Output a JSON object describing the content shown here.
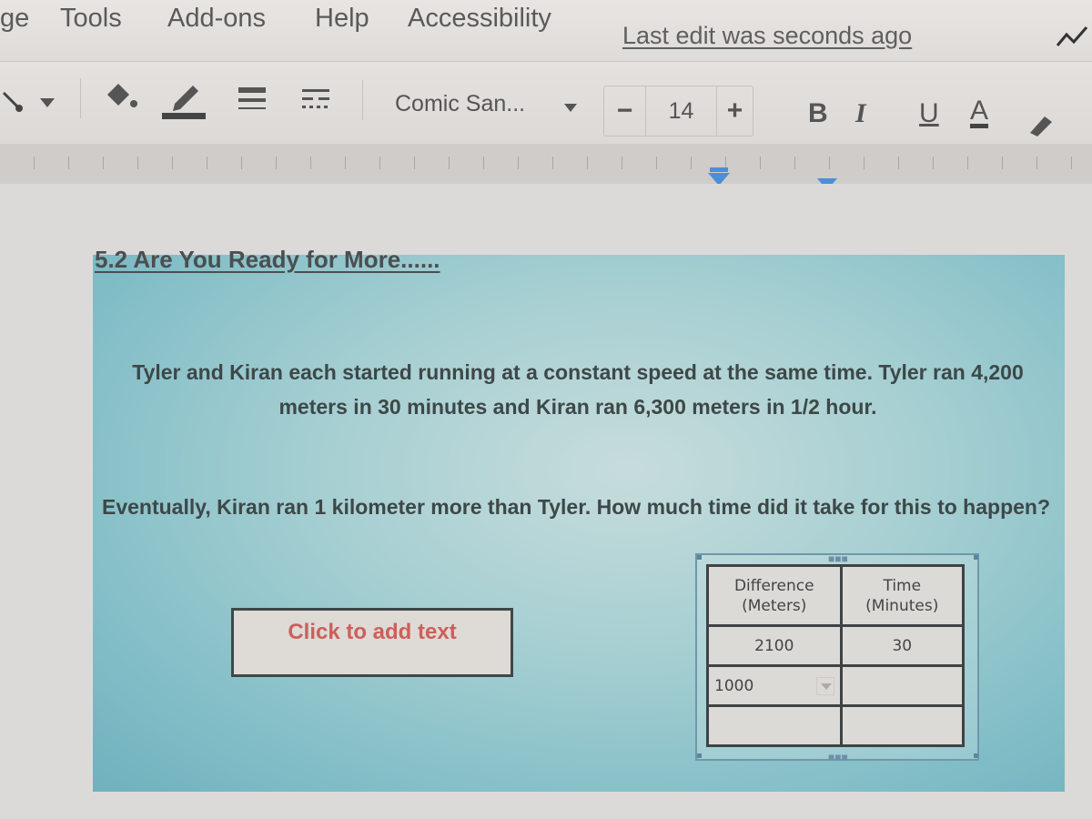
{
  "menubar": {
    "items": [
      "ge",
      "Tools",
      "Add-ons",
      "Help",
      "Accessibility"
    ],
    "last_edit": "Last edit was seconds ago"
  },
  "toolbar": {
    "icons": [
      "line-tool-icon",
      "fill-color-icon",
      "border-color-icon",
      "border-weight-icon",
      "border-dash-icon"
    ],
    "font_name": "Comic San...",
    "font_size": "14",
    "decrease_label": "−",
    "increase_label": "+",
    "bold_label": "B",
    "italic_label": "I",
    "underline_label": "U",
    "text_color_label": "A"
  },
  "slide": {
    "title": "5.2 Are You Ready for More......",
    "problem_text_1": "Tyler and Kiran each started running at a constant speed at the same time. Tyler ran 4,200 meters in 30 minutes and Kiran ran 6,300 meters in 1/2 hour.",
    "problem_text_2": "Eventually, Kiran ran 1 kilometer more than Tyler. How much time did it take for this to happen?",
    "placeholder": "Click to add text",
    "table": {
      "headers": [
        [
          "Difference",
          "(Meters)"
        ],
        [
          "Time",
          "(Minutes)"
        ]
      ],
      "rows": [
        [
          "2100",
          "30"
        ],
        [
          "1000",
          ""
        ],
        [
          "",
          ""
        ]
      ]
    }
  }
}
